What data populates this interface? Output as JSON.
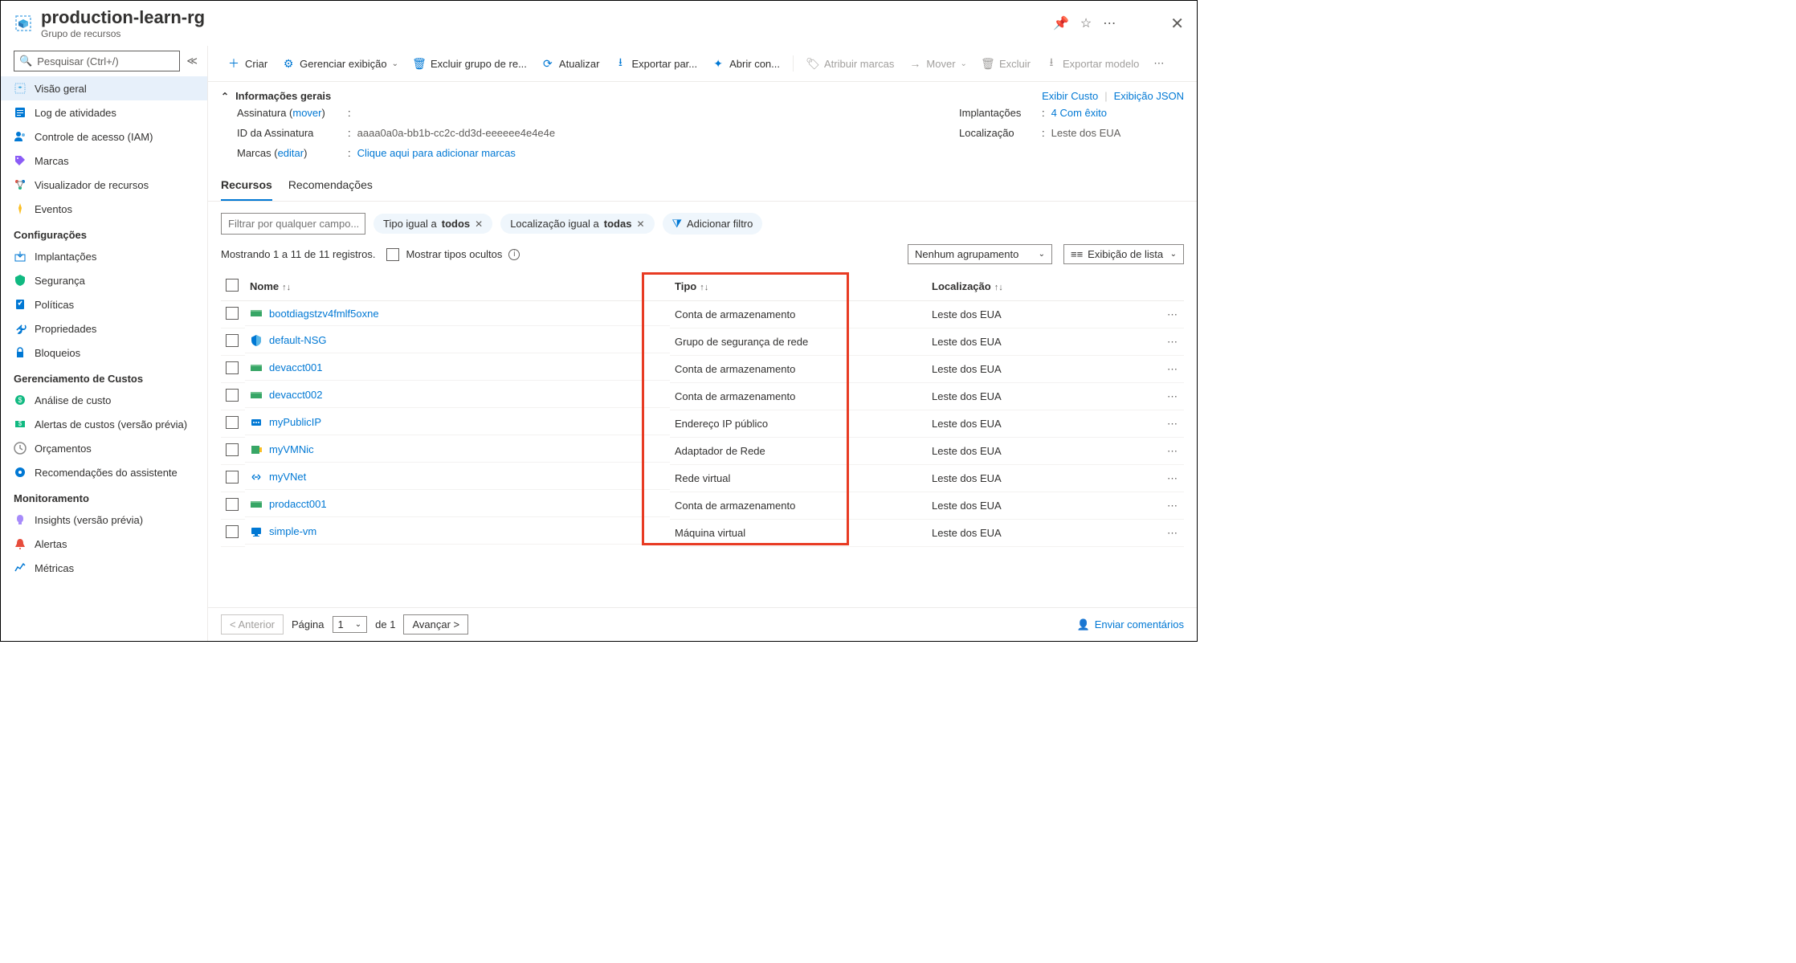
{
  "header": {
    "title": "production-learn-rg",
    "subtitle": "Grupo de recursos"
  },
  "sidebar": {
    "search_placeholder": "Pesquisar (Ctrl+/)",
    "items_main": [
      {
        "icon": "overview",
        "label": "Visão geral",
        "selected": true
      },
      {
        "icon": "activity",
        "label": "Log de atividades"
      },
      {
        "icon": "iam",
        "label": "Controle de acesso (IAM)"
      },
      {
        "icon": "tags",
        "label": "Marcas"
      },
      {
        "icon": "resviz",
        "label": "Visualizador de recursos"
      },
      {
        "icon": "events",
        "label": "Eventos"
      }
    ],
    "section_config": "Configurações",
    "items_config": [
      {
        "icon": "deploy",
        "label": "Implantações"
      },
      {
        "icon": "security",
        "label": "Segurança"
      },
      {
        "icon": "policy",
        "label": "Políticas"
      },
      {
        "icon": "props",
        "label": "Propriedades"
      },
      {
        "icon": "locks",
        "label": "Bloqueios"
      }
    ],
    "section_cost": "Gerenciamento de Custos",
    "items_cost": [
      {
        "icon": "costan",
        "label": "Análise de custo"
      },
      {
        "icon": "costal",
        "label": "Alertas de custos (versão prévia)"
      },
      {
        "icon": "budget",
        "label": "Orçamentos"
      },
      {
        "icon": "advisor",
        "label": "Recomendações do assistente"
      }
    ],
    "section_monitor": "Monitoramento",
    "items_monitor": [
      {
        "icon": "insights",
        "label": "Insights (versão prévia)"
      },
      {
        "icon": "alerts",
        "label": "Alertas"
      },
      {
        "icon": "metrics",
        "label": "Métricas"
      }
    ]
  },
  "toolbar": {
    "create": "Criar",
    "manage_view": "Gerenciar exibição",
    "delete_rg": "Excluir grupo de re...",
    "refresh": "Atualizar",
    "export_csv": "Exportar par...",
    "open_query": "Abrir con...",
    "assign_tags": "Atribuir marcas",
    "move": "Mover",
    "delete": "Excluir",
    "export_template": "Exportar modelo"
  },
  "essentials": {
    "title": "Informações gerais",
    "show_cost": "Exibir Custo",
    "json_view": "Exibição JSON",
    "sub_label": "Assinatura",
    "sub_move": "mover",
    "subid_label": "ID da Assinatura",
    "subid_value": "aaaa0a0a-bb1b-cc2c-dd3d-eeeeee4e4e4e",
    "tags_label": "Marcas",
    "tags_edit": "editar",
    "tags_value": "Clique aqui para adicionar marcas",
    "deploy_label": "Implantações",
    "deploy_value": "4 Com êxito",
    "loc_label": "Localização",
    "loc_value": "Leste dos EUA"
  },
  "tabs": {
    "resources": "Recursos",
    "recommendations": "Recomendações"
  },
  "filters": {
    "input_placeholder": "Filtrar por qualquer campo...",
    "type_pill_prefix": "Tipo igual a ",
    "type_pill_value": "todos",
    "loc_pill_prefix": "Localização igual a ",
    "loc_pill_value": "todas",
    "add_filter": "Adicionar filtro"
  },
  "status": {
    "showing": "Mostrando 1 a 11 de 11 registros.",
    "show_hidden": "Mostrar tipos ocultos",
    "grouping": "Nenhum agrupamento",
    "listview": "Exibição de lista"
  },
  "table": {
    "col_name": "Nome",
    "col_type": "Tipo",
    "col_loc": "Localização",
    "rows": [
      {
        "icon": "storage",
        "name": "bootdiagstzv4fmlf5oxne",
        "type": "Conta de armazenamento",
        "loc": "Leste dos EUA"
      },
      {
        "icon": "nsg",
        "name": "default-NSG",
        "type": "Grupo de segurança de rede",
        "loc": "Leste dos EUA"
      },
      {
        "icon": "storage",
        "name": "devacct001",
        "type": "Conta de armazenamento",
        "loc": "Leste dos EUA"
      },
      {
        "icon": "storage",
        "name": "devacct002",
        "type": "Conta de armazenamento",
        "loc": "Leste dos EUA"
      },
      {
        "icon": "pip",
        "name": "myPublicIP",
        "type": "Endereço IP público",
        "loc": "Leste dos EUA"
      },
      {
        "icon": "nic",
        "name": "myVMNic",
        "type": "Adaptador de Rede",
        "loc": "Leste dos EUA"
      },
      {
        "icon": "vnet",
        "name": "myVNet",
        "type": "Rede virtual",
        "loc": "Leste dos EUA"
      },
      {
        "icon": "storage",
        "name": "prodacct001",
        "type": "Conta de armazenamento",
        "loc": "Leste dos EUA"
      },
      {
        "icon": "vm",
        "name": "simple-vm",
        "type": "Máquina virtual",
        "loc": "Leste dos EUA"
      }
    ]
  },
  "pager": {
    "prev": "< Anterior",
    "page_label": "Página",
    "page_num": "1",
    "of": "de 1",
    "next": "Avançar >",
    "feedback": "Enviar comentários"
  }
}
